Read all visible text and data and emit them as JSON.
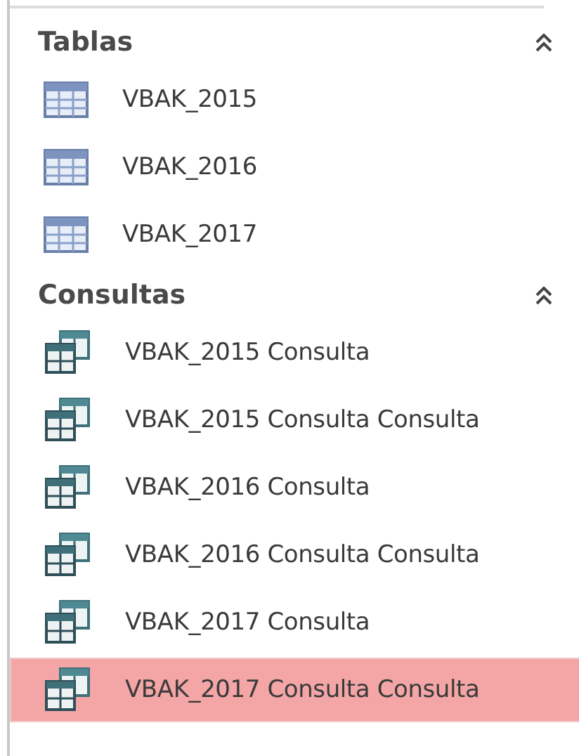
{
  "sections": [
    {
      "title": "Tablas",
      "expanded": true,
      "items": [
        {
          "label": "VBAK_2015",
          "kind": "table",
          "selected": false
        },
        {
          "label": "VBAK_2016",
          "kind": "table",
          "selected": false
        },
        {
          "label": "VBAK_2017",
          "kind": "table",
          "selected": false
        }
      ]
    },
    {
      "title": "Consultas",
      "expanded": true,
      "items": [
        {
          "label": "VBAK_2015 Consulta",
          "kind": "query",
          "selected": false
        },
        {
          "label": "VBAK_2015 Consulta Consulta",
          "kind": "query",
          "selected": false
        },
        {
          "label": "VBAK_2016 Consulta",
          "kind": "query",
          "selected": false
        },
        {
          "label": "VBAK_2016 Consulta Consulta",
          "kind": "query",
          "selected": false
        },
        {
          "label": "VBAK_2017 Consulta",
          "kind": "query",
          "selected": false
        },
        {
          "label": "VBAK_2017 Consulta Consulta",
          "kind": "query",
          "selected": true
        }
      ]
    }
  ]
}
